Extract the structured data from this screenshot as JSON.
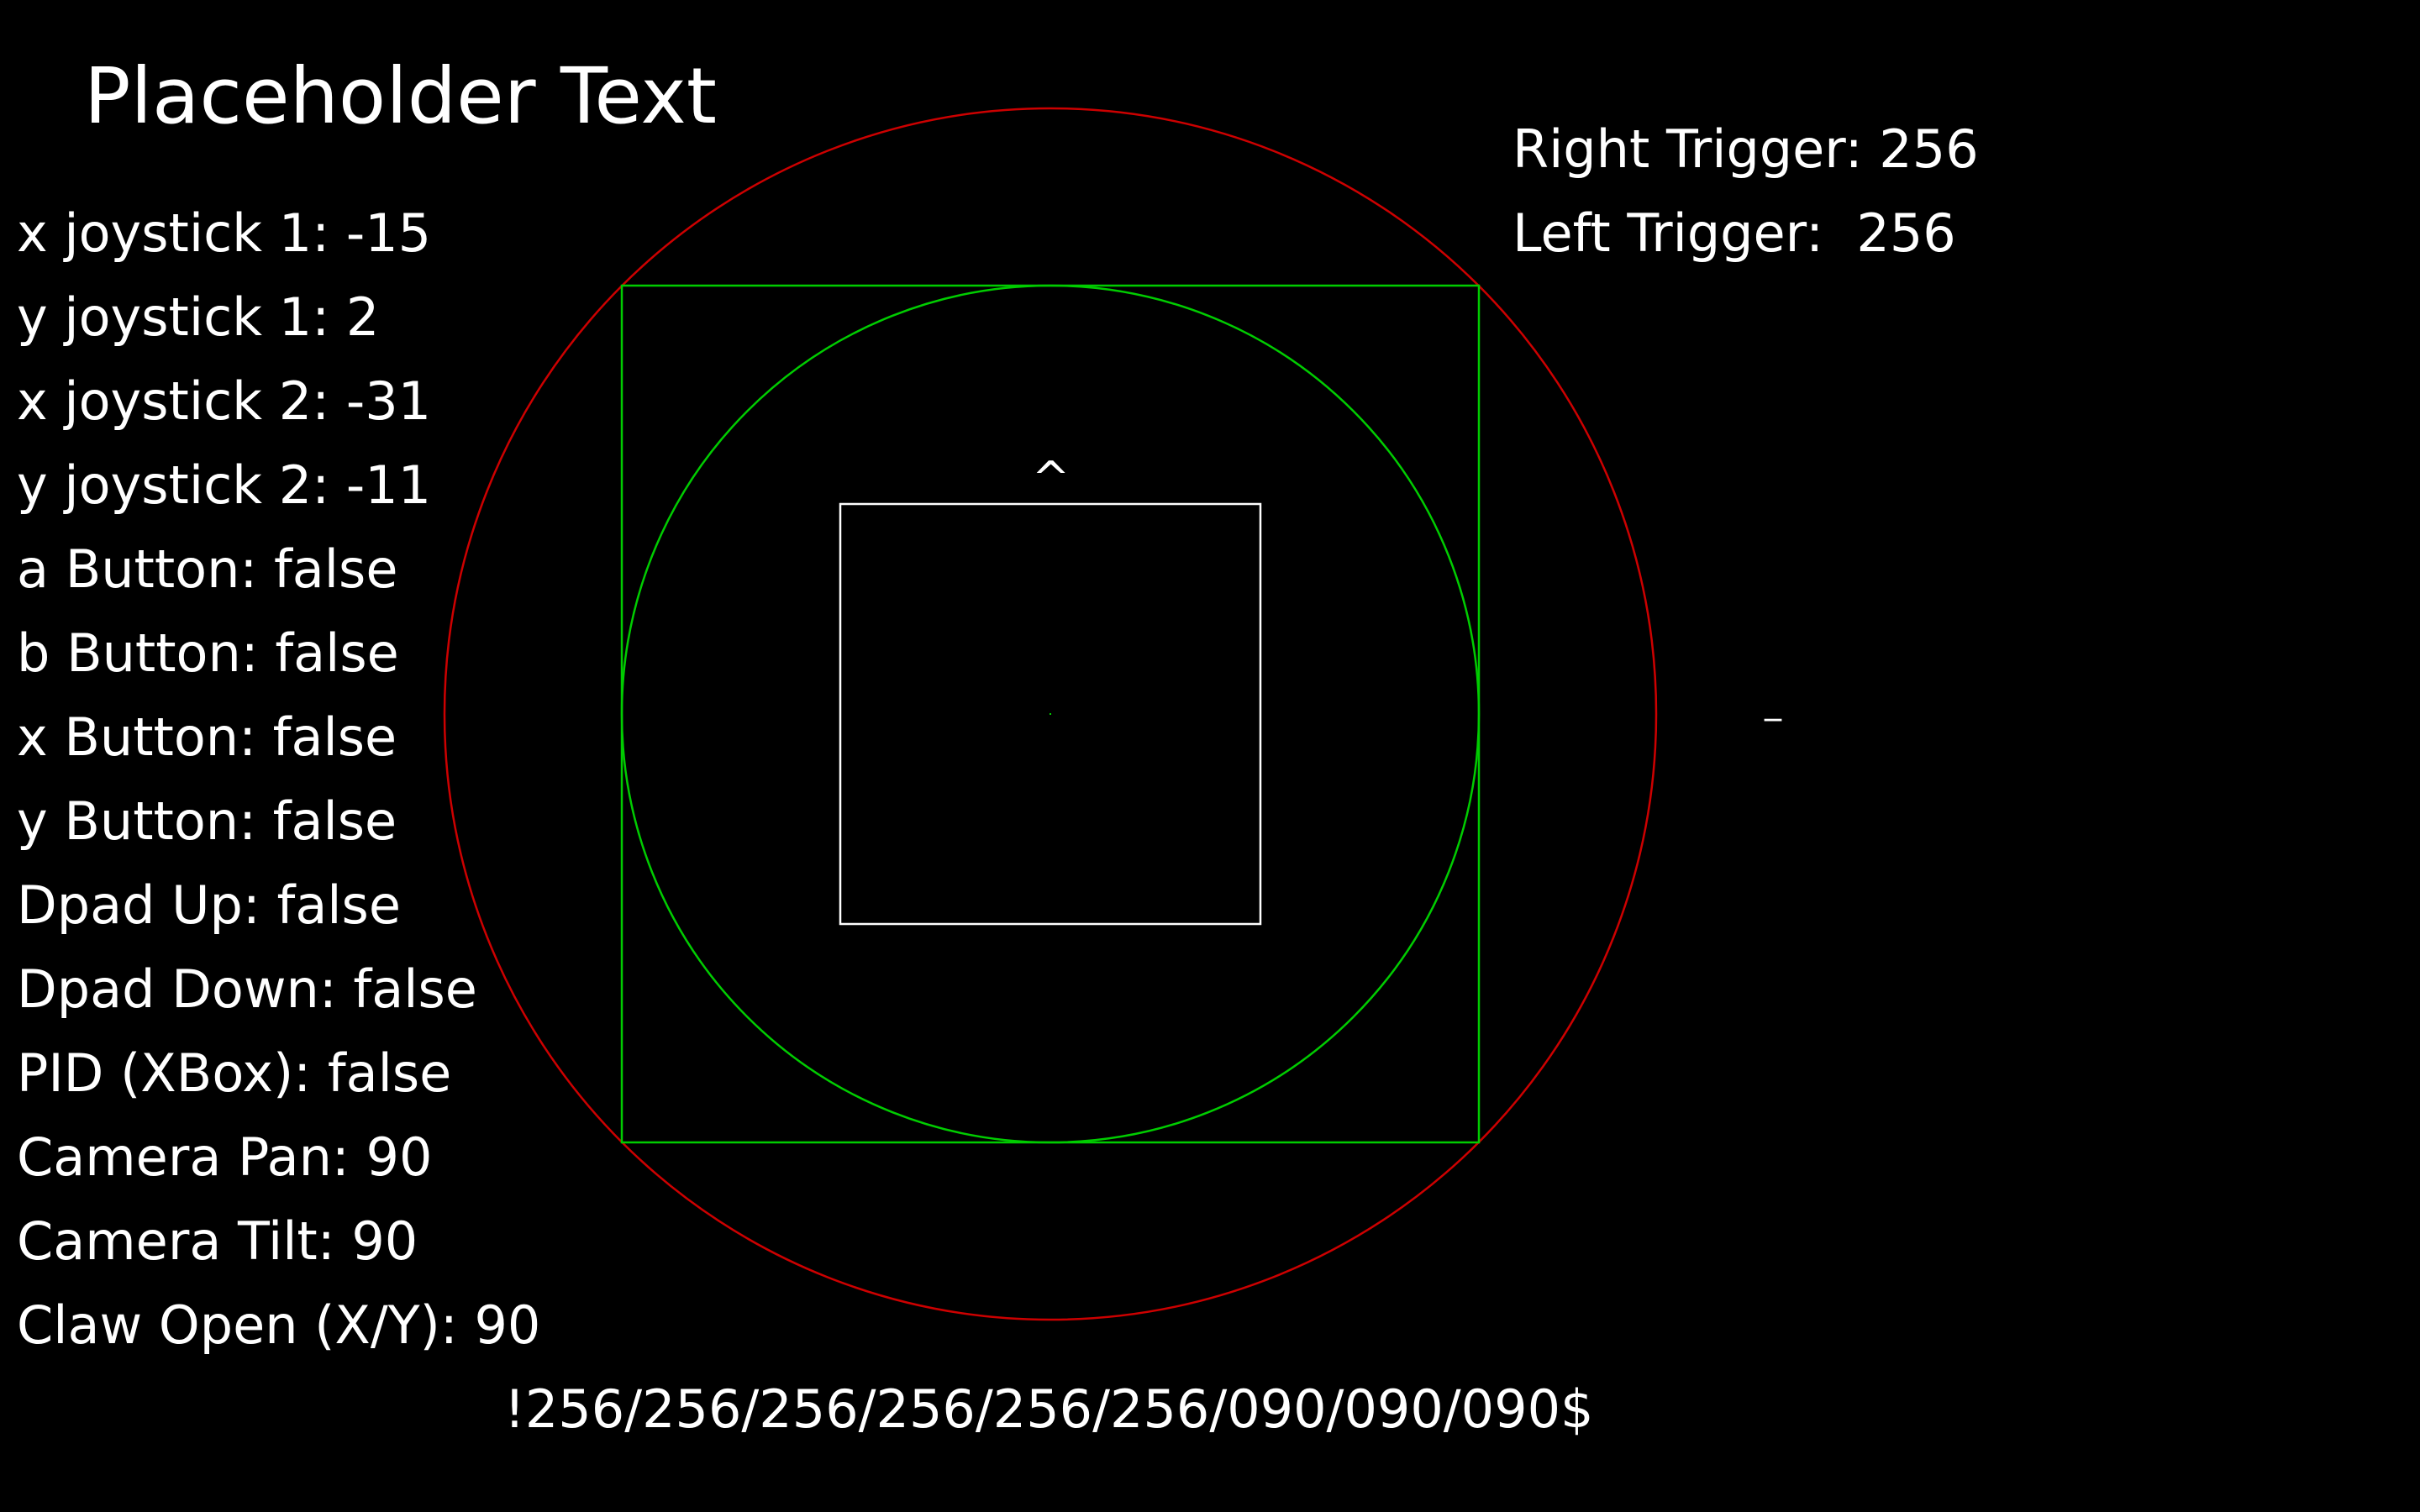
{
  "title": "Placeholder Text",
  "readouts": [
    "x joystick 1: -15",
    "y joystick 1: 2",
    "x joystick 2: -31",
    "y joystick 2: -11",
    "a Button: false",
    "b Button: false",
    "x Button: false",
    "y Button: false",
    "Dpad Up: false",
    "Dpad Down: false",
    "PID (XBox): false",
    "Camera Pan: 90",
    "Camera Tilt: 90",
    "Claw Open (X/Y): 90"
  ],
  "triggers": {
    "right": "Right Trigger: 256",
    "left": "Left Trigger:  256"
  },
  "packet": "!256/256/256/256/256/256/090/090/090$",
  "direction_marker": "^",
  "side_marker": "_",
  "colors": {
    "background": "#000000",
    "text": "#ffffff",
    "outer_circle": "#cc0000",
    "inner_shapes": "#00cc00",
    "center_box": "#ffffff"
  }
}
